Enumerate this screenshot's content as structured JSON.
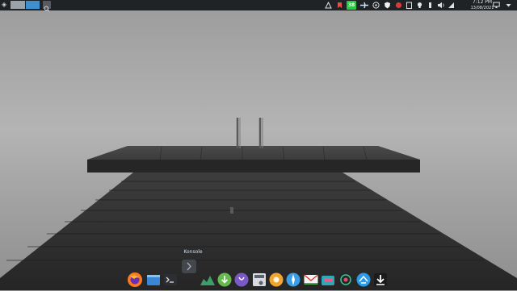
{
  "panel": {
    "clock_time": "7:12 PM",
    "clock_date": "13/08/2021",
    "battery_percent": "38",
    "tray_icons": [
      "kde-connect-icon",
      "bookmark-icon",
      "battery-status-icon",
      "plane-icon",
      "vpn-icon",
      "shield-icon",
      "record-icon",
      "clipboard-icon",
      "bulb-icon",
      "usb-icon",
      "volume-icon",
      "wifi-icon",
      "display-icon",
      "menu-arrow-icon"
    ]
  },
  "pager": {
    "desktops": 2,
    "active": 1
  },
  "dock": {
    "tooltip": "Konsole",
    "items": [
      "firefox-icon",
      "files-icon",
      "terminal-icon",
      "system-monitor-icon",
      "download-manager-icon",
      "chat-icon",
      "disk-utility-icon",
      "settings-icon",
      "safari-icon",
      "email-icon",
      "mailbox-icon",
      "globe-icon",
      "app-store-icon",
      "downloads-icon"
    ]
  },
  "colors": {
    "panel": "#1f2326",
    "accent": "#3daee9",
    "battery_green": "#28c840"
  }
}
